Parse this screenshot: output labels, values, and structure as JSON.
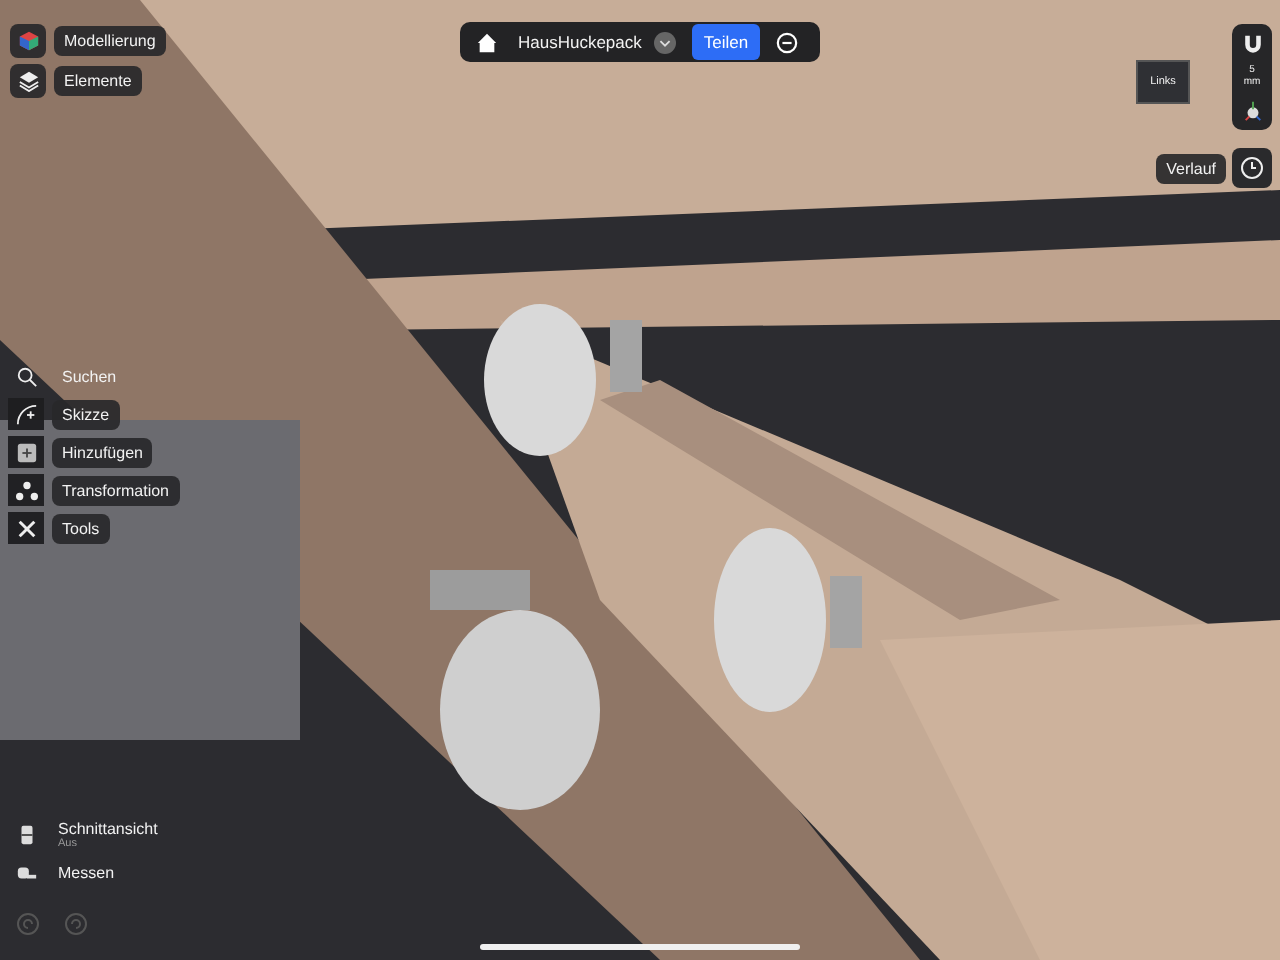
{
  "workspace_menu": [
    {
      "label": "Modellierung",
      "kind": "workspace"
    },
    {
      "label": "Elemente",
      "kind": "items"
    }
  ],
  "title_bar": {
    "project": "HausHuckepack",
    "share": "Teilen"
  },
  "view_cube": {
    "face": "Links"
  },
  "snap": {
    "value": "5",
    "unit": "mm"
  },
  "history": {
    "label": "Verlauf"
  },
  "tools": [
    {
      "label": "Suchen",
      "kind": "search"
    },
    {
      "label": "Skizze",
      "kind": "sketch"
    },
    {
      "label": "Hinzufügen",
      "kind": "add"
    },
    {
      "label": "Transformation",
      "kind": "transform"
    },
    {
      "label": "Tools",
      "kind": "tools"
    }
  ],
  "bottom_tools": [
    {
      "label": "Schnittansicht",
      "status": "Aus",
      "kind": "section"
    },
    {
      "label": "Messen",
      "kind": "measure"
    }
  ]
}
